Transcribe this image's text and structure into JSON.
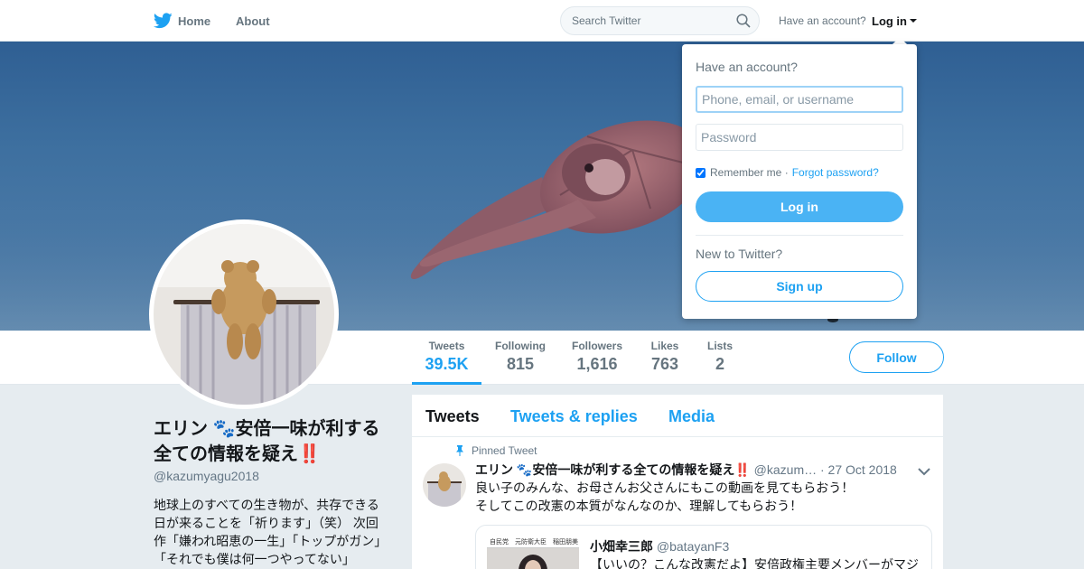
{
  "nav": {
    "home_label": "Home",
    "about_label": "About",
    "search_placeholder": "Search Twitter",
    "have_account": "Have an account?",
    "login_label": "Log in"
  },
  "profile": {
    "name": "エリン 🐾安倍一味が利する全ての情報を疑え‼️",
    "handle": "@kazumyagu2018",
    "bio": "地球上のすべての生き物が、共存できる日が来ることを「祈ります」（笑） 次回作「嫌われ昭恵の一生」「トップがガン」「それでも僕は何一つやってない」"
  },
  "stats": [
    {
      "label": "Tweets",
      "value": "39.5K"
    },
    {
      "label": "Following",
      "value": "815"
    },
    {
      "label": "Followers",
      "value": "1,616"
    },
    {
      "label": "Likes",
      "value": "763"
    },
    {
      "label": "Lists",
      "value": "2"
    }
  ],
  "follow_label": "Follow",
  "timeline": {
    "tabs": [
      "Tweets",
      "Tweets & replies",
      "Media"
    ],
    "pinned_label": "Pinned Tweet",
    "tweet": {
      "name": "エリン 🐾安倍一味が利する全ての情報を疑え‼️",
      "handle": "@kazum…",
      "date": "· 27 Oct 2018",
      "text_line1": "良い子のみんな、お母さんお父さんにもこの動画を見てもらおう！",
      "text_line2": "そしてこの改憲の本質がなんなのか、理解してもらおう！",
      "quote": {
        "name": "小畑幸三郎",
        "handle": "@batayanF3",
        "text": "【いいの？こんな改憲だよ】安倍政権主要メンバーがマジ",
        "thumb_text": "自民党　元防衛大臣　稲田朋美"
      }
    }
  },
  "login_dropdown": {
    "title": "Have an account?",
    "username_placeholder": "Phone, email, or username",
    "password_placeholder": "Password",
    "remember_label": "Remember me",
    "forgot_label": "Forgot password?",
    "login_button": "Log in",
    "new_label": "New to Twitter?",
    "signup_button": "Sign up"
  },
  "colors": {
    "accent": "#1da1f2",
    "login_button": "#4ab3f4",
    "background": "#e6ecf0"
  }
}
